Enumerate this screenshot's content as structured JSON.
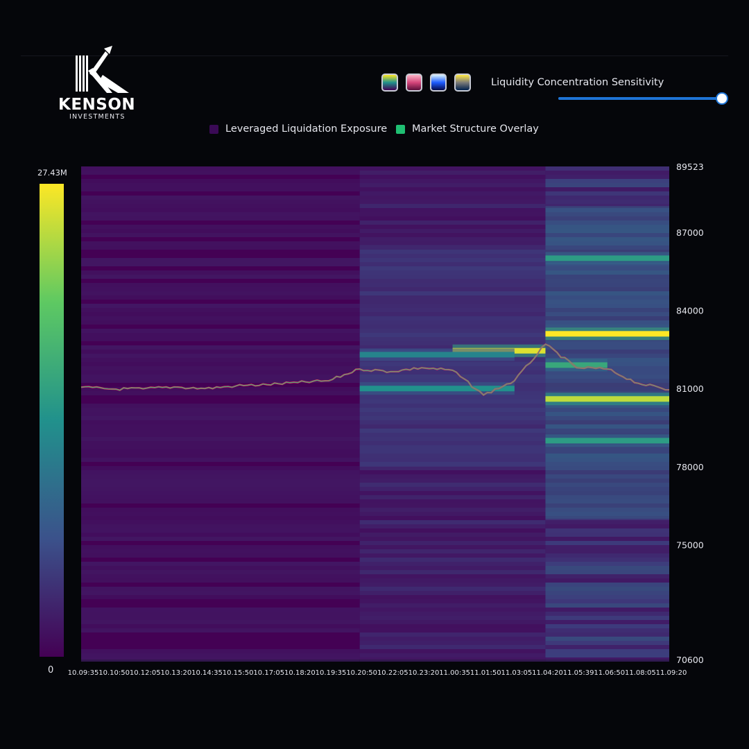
{
  "brand": {
    "name": "KENSON",
    "subtitle": "INVESTMENTS"
  },
  "controls": {
    "swatches": [
      {
        "name": "viridis",
        "colors": [
          "#fde725",
          "#21918c",
          "#440154"
        ]
      },
      {
        "name": "magma",
        "colors": [
          "#fcb6c8",
          "#d5467a",
          "#5a0f3a"
        ]
      },
      {
        "name": "blue-band",
        "colors": [
          "#d9f4ff",
          "#1d5bff",
          "#050a4a"
        ]
      },
      {
        "name": "cividis",
        "colors": [
          "#ffe945",
          "#7c7b78",
          "#00224e"
        ]
      }
    ],
    "sensitivity_label": "Liquidity Concentration Sensitivity",
    "sensitivity_value": 1.0
  },
  "legend": [
    {
      "label": "Leveraged Liquidation Exposure",
      "color": "#3a0a55"
    },
    {
      "label": "Market Structure Overlay",
      "color": "#1fbf72"
    }
  ],
  "colorbar": {
    "max_label": "27.43M",
    "min_label": "0",
    "colors": [
      "#440154",
      "#3b528b",
      "#21918c",
      "#5ec962",
      "#fde725"
    ]
  },
  "chart_data": {
    "type": "heatmap",
    "x_tick_labels": [
      "10.09:35",
      "10.10:50",
      "10.12:05",
      "10.13:20",
      "10.14:35",
      "10.15:50",
      "10.17:05",
      "10.18:20",
      "10.19:35",
      "10.20:50",
      "10.22:05",
      "10.23:20",
      "11.00:35",
      "11.01:50",
      "11.03:05",
      "11.04:20",
      "11.05:39",
      "11.06:50",
      "11.08:05",
      "11.09:20"
    ],
    "y_tick_labels": [
      "89523",
      "87000",
      "84000",
      "81000",
      "78000",
      "75000",
      "70600"
    ],
    "y_tick_values": [
      89523,
      87000,
      84000,
      81000,
      78000,
      75000,
      70600
    ],
    "ylim": [
      70600,
      89523
    ],
    "colorscale_range": [
      0,
      27430000
    ],
    "intensity_bands": [
      {
        "price": 83100,
        "from": "11.04:20",
        "to": "11.09:20",
        "level": 1.0
      },
      {
        "price": 82450,
        "from": "11.00:35",
        "to": "11.04:20",
        "level": 0.95
      },
      {
        "price": 80600,
        "from": "11.04:20",
        "to": "11.09:20",
        "level": 0.9
      },
      {
        "price": 81900,
        "from": "11.04:20",
        "to": "11.06:50",
        "level": 0.6
      },
      {
        "price": 86000,
        "from": "11.04:20",
        "to": "11.09:20",
        "level": 0.55
      },
      {
        "price": 79000,
        "from": "11.04:20",
        "to": "11.09:20",
        "level": 0.55
      },
      {
        "price": 81000,
        "from": "10.20:50",
        "to": "11.03:05",
        "level": 0.5
      },
      {
        "price": 82300,
        "from": "10.20:50",
        "to": "11.03:05",
        "level": 0.45
      }
    ],
    "price_series": {
      "name": "Price",
      "x": [
        "10.09:35",
        "10.10:50",
        "10.12:05",
        "10.13:20",
        "10.14:35",
        "10.15:50",
        "10.17:05",
        "10.18:20",
        "10.19:35",
        "10.20:50",
        "10.22:05",
        "10.23:20",
        "11.00:35",
        "11.01:50",
        "11.03:05",
        "11.04:20",
        "11.05:39",
        "11.06:50",
        "11.08:05",
        "11.09:20"
      ],
      "y": [
        81050,
        80980,
        80990,
        81060,
        81000,
        81100,
        81150,
        81230,
        81300,
        81750,
        81650,
        81800,
        81700,
        80750,
        81300,
        82700,
        81800,
        81750,
        81200,
        80950
      ]
    }
  }
}
